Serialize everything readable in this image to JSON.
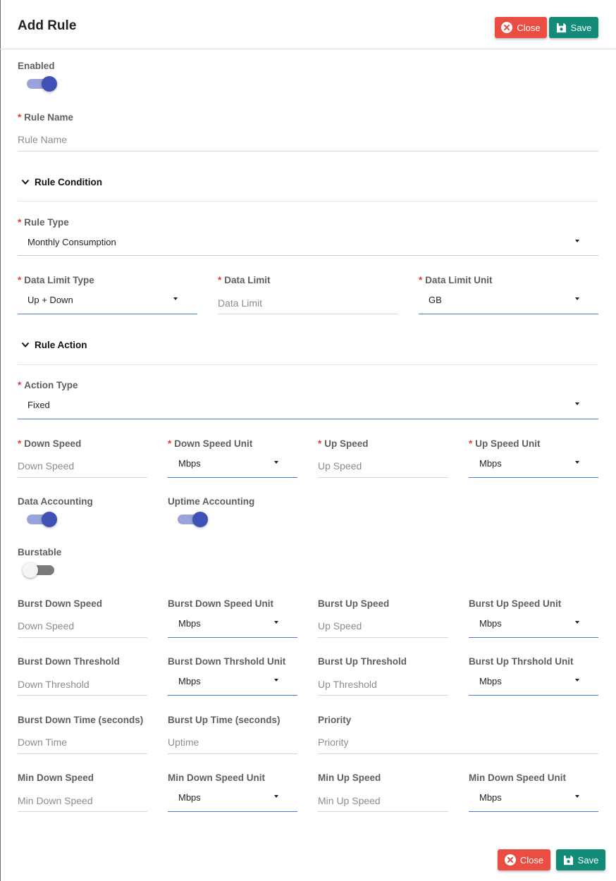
{
  "header": {
    "title": "Add Rule",
    "close_label": "Close",
    "save_label": "Save"
  },
  "footer": {
    "close_label": "Close",
    "save_label": "Save"
  },
  "colors": {
    "close": "#ec4d43",
    "save": "#128b79",
    "toggle_on": "#3f51b5",
    "required": "#e53935",
    "underline_active": "#3b7fd0"
  },
  "enabled": {
    "label": "Enabled",
    "on": true
  },
  "rule_name": {
    "label": "Rule Name",
    "placeholder": "Rule Name"
  },
  "rule_condition": {
    "title": "Rule Condition",
    "rule_type": {
      "label": "Rule Type",
      "value": "Monthly Consumption"
    },
    "data_limit_type": {
      "label": "Data Limit Type",
      "value": "Up + Down"
    },
    "data_limit": {
      "label": "Data Limit",
      "placeholder": "Data Limit"
    },
    "data_limit_unit": {
      "label": "Data Limit Unit",
      "value": "GB"
    }
  },
  "rule_action": {
    "title": "Rule Action",
    "action_type": {
      "label": "Action Type",
      "value": "Fixed"
    },
    "down_speed": {
      "label": "Down Speed",
      "placeholder": "Down Speed"
    },
    "down_speed_unit": {
      "label": "Down Speed Unit",
      "value": "Mbps"
    },
    "up_speed": {
      "label": "Up Speed",
      "placeholder": "Up Speed"
    },
    "up_speed_unit": {
      "label": "Up Speed Unit",
      "value": "Mbps"
    },
    "data_accounting": {
      "label": "Data Accounting",
      "on": true
    },
    "uptime_accounting": {
      "label": "Uptime Accounting",
      "on": true
    },
    "burstable": {
      "label": "Burstable",
      "on": false
    },
    "burst_down_speed": {
      "label": "Burst Down Speed",
      "placeholder": "Down Speed"
    },
    "burst_down_speed_unit": {
      "label": "Burst Down Speed Unit",
      "value": "Mbps"
    },
    "burst_up_speed": {
      "label": "Burst Up Speed",
      "placeholder": "Up Speed"
    },
    "burst_up_speed_unit": {
      "label": "Burst Up Speed Unit",
      "value": "Mbps"
    },
    "burst_down_threshold": {
      "label": "Burst Down Threshold",
      "placeholder": "Down Threshold"
    },
    "burst_down_threshold_unit": {
      "label": "Burst Down Thrshold Unit",
      "value": "Mbps"
    },
    "burst_up_threshold": {
      "label": "Burst Up Threshold",
      "placeholder": "Up Threshold"
    },
    "burst_up_threshold_unit": {
      "label": "Burst Up Thrshold Unit",
      "value": "Mbps"
    },
    "burst_down_time": {
      "label": "Burst Down Time (seconds)",
      "placeholder": "Down Time"
    },
    "burst_up_time": {
      "label": "Burst Up Time (seconds)",
      "placeholder": "Uptime"
    },
    "priority": {
      "label": "Priority",
      "placeholder": "Priority"
    },
    "min_down_speed": {
      "label": "Min Down Speed",
      "placeholder": "Min Down Speed"
    },
    "min_down_speed_unit": {
      "label": "Min Down Speed Unit",
      "value": "Mbps"
    },
    "min_up_speed": {
      "label": "Min Up Speed",
      "placeholder": "Min Up Speed"
    },
    "min_up_speed_unit": {
      "label": "Min Down Speed Unit",
      "value": "Mbps"
    }
  }
}
